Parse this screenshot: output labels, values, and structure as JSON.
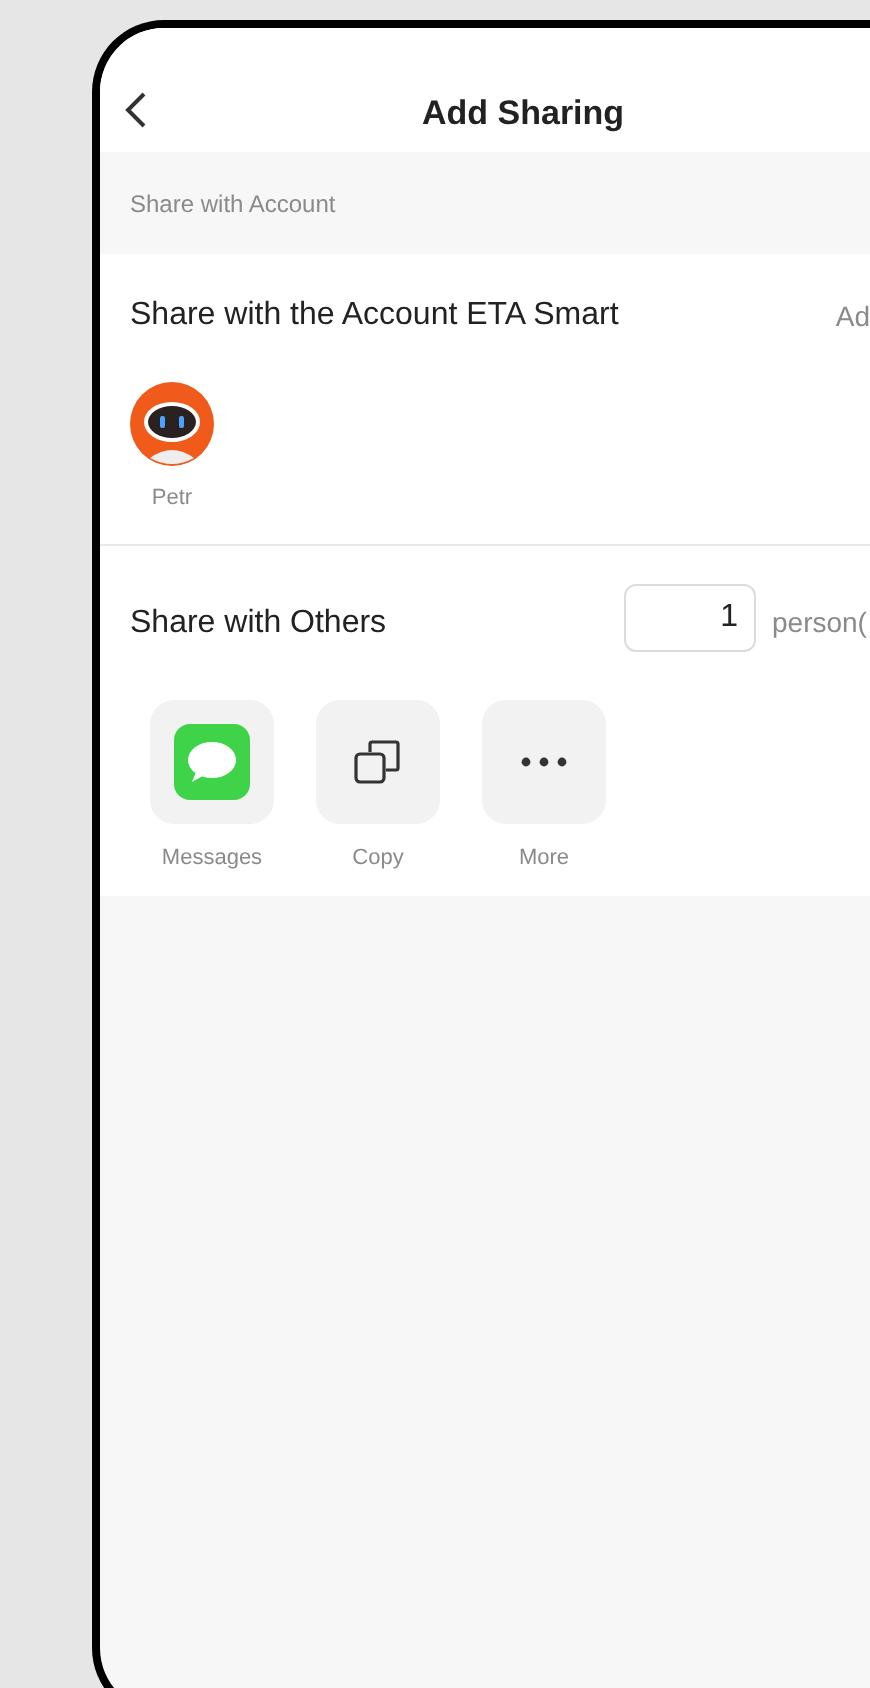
{
  "header": {
    "title": "Add Sharing"
  },
  "account_section": {
    "label": "Share with Account",
    "title": "Share with the Account ETA Smart",
    "action": "Ad",
    "members": [
      {
        "name": "Petr"
      }
    ]
  },
  "others_section": {
    "title": "Share with Others",
    "count": "1",
    "unit": "person(",
    "options": [
      {
        "kind": "messages",
        "label": "Messages"
      },
      {
        "kind": "copy",
        "label": "Copy"
      },
      {
        "kind": "more",
        "label": "More"
      }
    ]
  }
}
